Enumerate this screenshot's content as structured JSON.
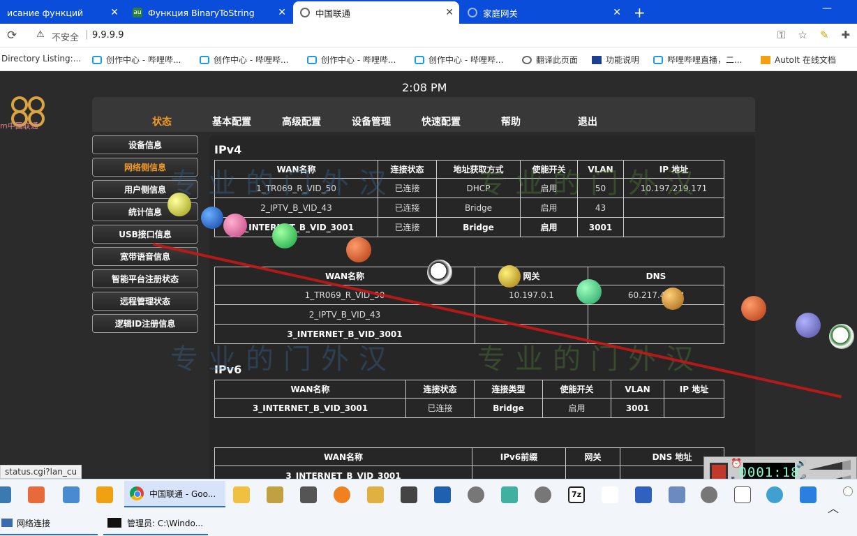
{
  "browser": {
    "tabs": [
      {
        "label": "исание функций",
        "active": false
      },
      {
        "label": "Функция BinaryToString",
        "active": false
      },
      {
        "label": "中国联通",
        "active": true
      },
      {
        "label": "家庭网关",
        "active": false
      }
    ],
    "new_tab": "+",
    "minimize": "—",
    "address": {
      "insecure_label": "不安全",
      "url": "9.9.9.9"
    },
    "bookmarks": [
      "Directory Listing:...",
      "创作中心 - 哔哩哔...",
      "创作中心 - 哔哩哔...",
      "创作中心 - 哔哩哔...",
      "创作中心 - 哔哩哔...",
      "翻译此页面",
      "功能说明",
      "哔哩哔哩直播，二...",
      "AutoIt 在线文档"
    ]
  },
  "router": {
    "logo_text": "m中国联通",
    "clock": "2:08 PM",
    "nav": [
      {
        "label": "状态",
        "active": true
      },
      {
        "label": "基本配置",
        "active": false
      },
      {
        "label": "高级配置",
        "active": false
      },
      {
        "label": "设备管理",
        "active": false
      },
      {
        "label": "快速配置",
        "active": false
      },
      {
        "label": "帮助",
        "active": false
      },
      {
        "label": "退出",
        "active": false
      }
    ],
    "sidebar": [
      {
        "label": "设备信息",
        "active": false
      },
      {
        "label": "网络侧信息",
        "active": true
      },
      {
        "label": "用户侧信息",
        "active": false
      },
      {
        "label": "统计信息",
        "active": false
      },
      {
        "label": "USB接口信息",
        "active": false
      },
      {
        "label": "宽带语音信息",
        "active": false
      },
      {
        "label": "智能平台注册状态",
        "active": false
      },
      {
        "label": "远程管理状态",
        "active": false
      },
      {
        "label": "逻辑ID注册信息",
        "active": false
      }
    ],
    "ipv4_title": "IPv4",
    "ipv4_table": {
      "headers": [
        "WAN名称",
        "连接状态",
        "地址获取方式",
        "使能开关",
        "VLAN",
        "IP 地址"
      ],
      "rows": [
        [
          "1_TR069_R_VID_50",
          "已连接",
          "DHCP",
          "启用",
          "50",
          "10.197.219.171"
        ],
        [
          "2_IPTV_B_VID_43",
          "已连接",
          "Bridge",
          "启用",
          "43",
          ""
        ],
        [
          "3_INTERNET_B_VID_3001",
          "已连接",
          "Bridge",
          "启用",
          "3001",
          ""
        ]
      ]
    },
    "ipv4_dns_table": {
      "headers": [
        "WAN名称",
        "网关",
        "DNS"
      ],
      "rows": [
        [
          "1_TR069_R_VID_50",
          "10.197.0.1",
          "60.217.41.38"
        ],
        [
          "2_IPTV_B_VID_43",
          "",
          ""
        ],
        [
          "3_INTERNET_B_VID_3001",
          "",
          ""
        ]
      ]
    },
    "ipv6_title": "IPv6",
    "ipv6_table": {
      "headers": [
        "WAN名称",
        "连接状态",
        "连接类型",
        "使能开关",
        "VLAN",
        "IP 地址"
      ],
      "rows": [
        [
          "3_INTERNET_B_VID_3001",
          "已连接",
          "Bridge",
          "启用",
          "3001",
          ""
        ]
      ]
    },
    "ipv6_prefix_table": {
      "headers": [
        "WAN名称",
        "IPv6前缀",
        "网关",
        "DNS 地址"
      ],
      "rows": [
        [
          "3_INTERNET_B_VID_3001",
          "",
          "",
          ""
        ]
      ]
    },
    "watermark": "专业的门外汉"
  },
  "status_url": "status.cgi?lan_cu",
  "taskbar": {
    "active_window": "中国联通 - Goo...",
    "row2": [
      {
        "label": "网络连接"
      },
      {
        "label": "管理员: C:\\Windo..."
      }
    ],
    "recorder_timer": "0001:18"
  }
}
